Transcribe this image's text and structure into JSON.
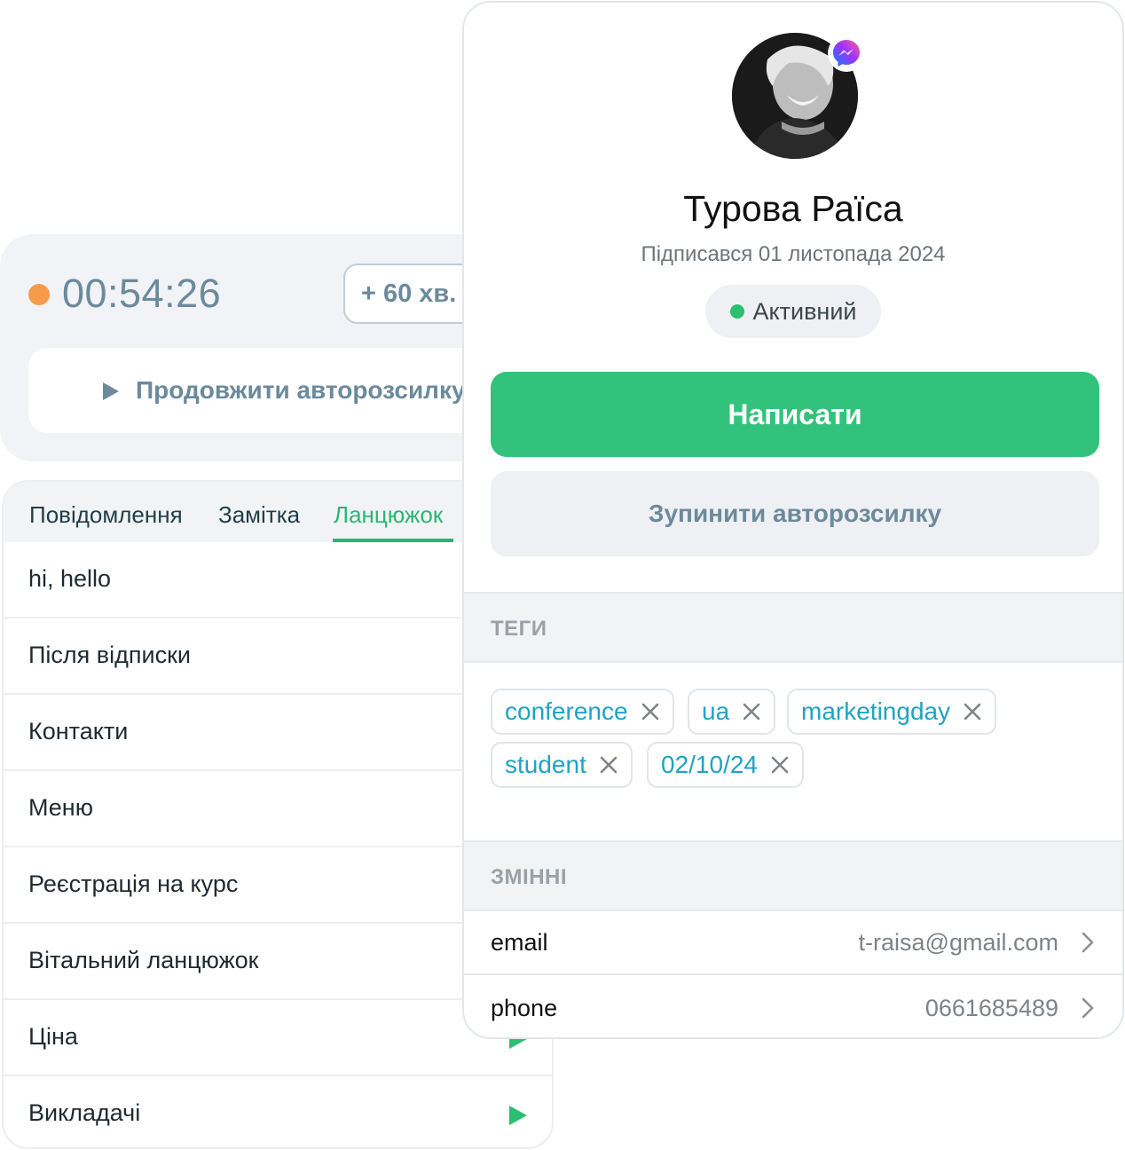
{
  "timer": {
    "time": "00:54:26",
    "extend_label": "+ 60 хв.",
    "resume_label": "Продовжити авторозсилку"
  },
  "tabs": [
    {
      "label": "Повідомлення",
      "active": false
    },
    {
      "label": "Замітка",
      "active": false
    },
    {
      "label": "Ланцюжок",
      "active": true
    }
  ],
  "list": [
    {
      "label": "hi, hello"
    },
    {
      "label": "Після відписки"
    },
    {
      "label": "Контакти"
    },
    {
      "label": "Меню"
    },
    {
      "label": "Реєстрація на курс"
    },
    {
      "label": "Вітальний ланцюжок"
    },
    {
      "label": "Ціна"
    },
    {
      "label": "Викладачі"
    }
  ],
  "profile": {
    "name": "Турова Раїса",
    "subscribed": "Підписався 01 листопада 2024",
    "status": "Активний",
    "channel_icon": "messenger-icon",
    "write_label": "Написати",
    "stop_label": "Зупинити авторозсилку"
  },
  "tags_section": {
    "title": "ТЕГИ",
    "tags": [
      "conference",
      "ua",
      "marketingday",
      "student",
      "02/10/24"
    ]
  },
  "variables_section": {
    "title": "ЗМІННІ",
    "rows": [
      {
        "key": "email",
        "value": "t-raisa@gmail.com"
      },
      {
        "key": "phone",
        "value": "0661685489"
      }
    ]
  },
  "colors": {
    "accent_green": "#33c27b",
    "timer_dot": "#f79a4a",
    "tag_text": "#1fa3c4",
    "muted_blue": "#6b8a9c"
  }
}
